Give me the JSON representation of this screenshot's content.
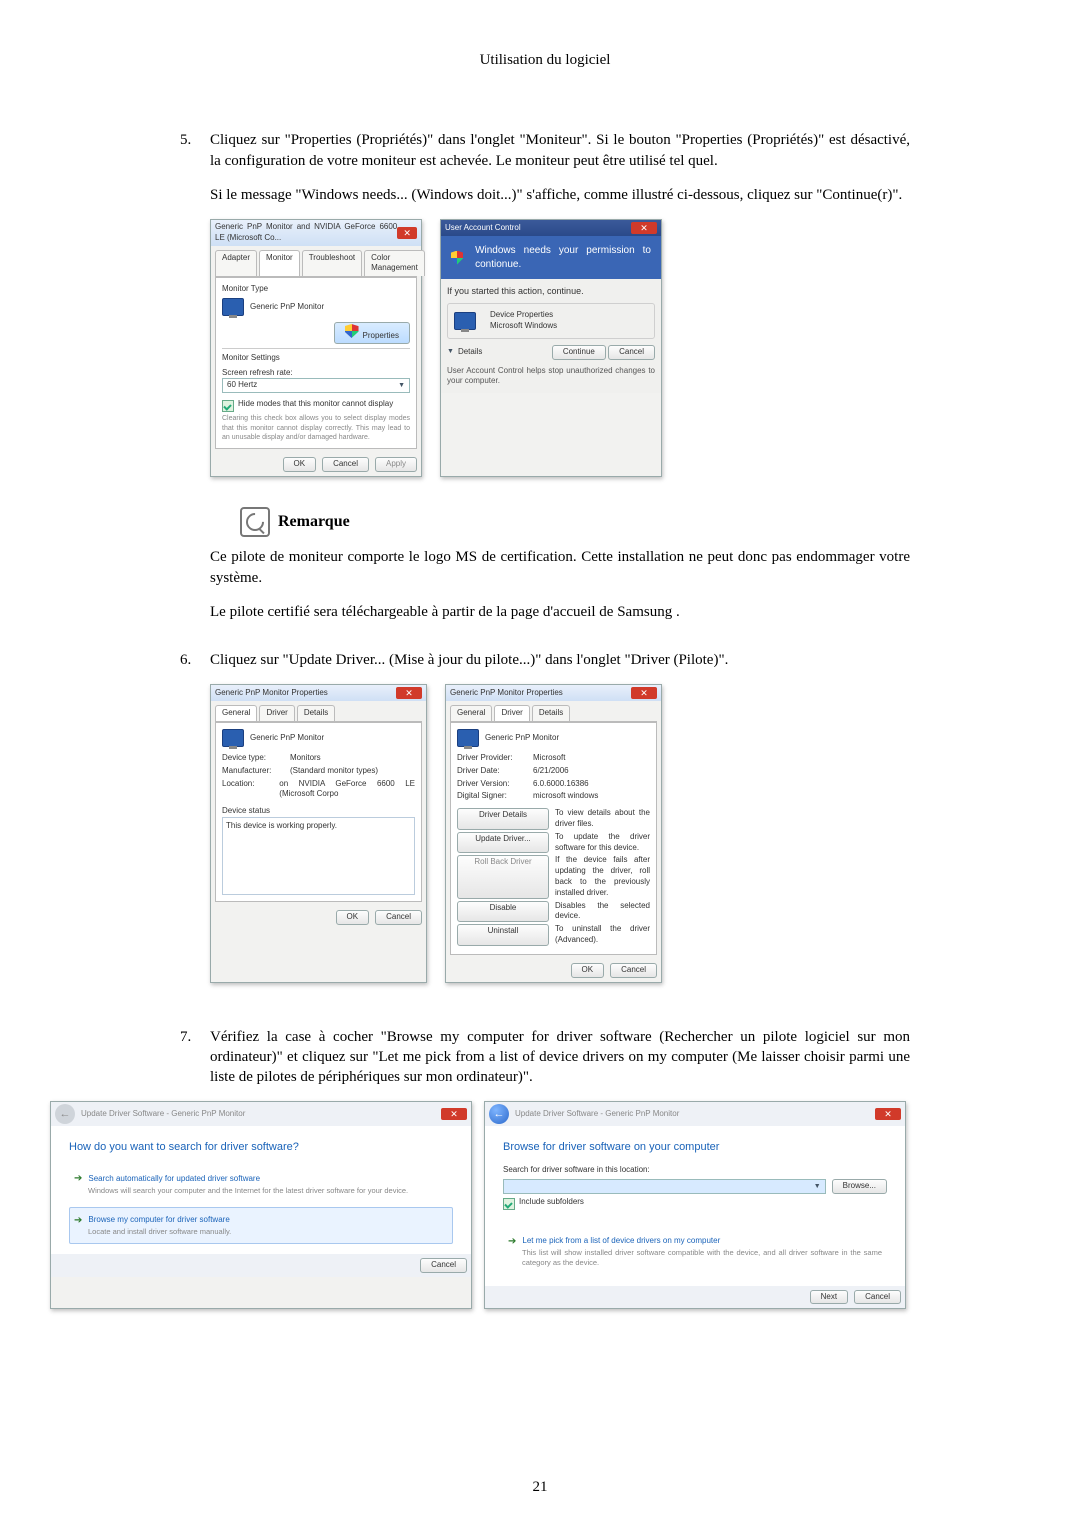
{
  "running_head": "Utilisation du logiciel",
  "page_number": "21",
  "step5": {
    "num": "5.",
    "para1": "Cliquez sur \"Properties (Propriétés)\" dans l'onglet \"Moniteur\". Si le bouton \"Properties (Propriétés)\" est désactivé, la configuration de votre moniteur est achevée. Le moniteur peut être utilisé tel quel.",
    "para2": "Si le message \"Windows needs... (Windows doit...)\" s'affiche, comme illustré ci-dessous, cliquez sur \"Continue(r)\"."
  },
  "fig1_left": {
    "title": "Generic PnP Monitor and NVIDIA GeForce 6600 LE (Microsoft Co...",
    "tabs": [
      "Adapter",
      "Monitor",
      "Troubleshoot",
      "Color Management"
    ],
    "monitor_type_label": "Monitor Type",
    "monitor_name": "Generic PnP Monitor",
    "properties_btn": "Properties",
    "monitor_settings_label": "Monitor Settings",
    "refresh_label": "Screen refresh rate:",
    "refresh_value": "60 Hertz",
    "hide_modes": "Hide modes that this monitor cannot display",
    "hide_modes_desc": "Clearing this check box allows you to select display modes that this monitor cannot display correctly. This may lead to an unusable display and/or damaged hardware.",
    "ok": "OK",
    "cancel": "Cancel",
    "apply": "Apply"
  },
  "fig1_right": {
    "title": "User Account Control",
    "headline": "Windows needs your permission to contionue.",
    "started": "If you started this action, continue.",
    "prog": "Device Properties",
    "publisher": "Microsoft Windows",
    "details": "Details",
    "continue": "Continue",
    "cancel": "Cancel",
    "footer": "User Account Control helps stop unauthorized changes to your computer."
  },
  "note": {
    "title": "Remarque",
    "p1": "Ce pilote de moniteur comporte le logo MS de certification. Cette installation ne peut donc pas endommager votre système.",
    "p2": "Le pilote certifié sera téléchargeable à partir de la page d'accueil de Samsung ."
  },
  "step6": {
    "num": "6.",
    "text": "Cliquez sur \"Update Driver... (Mise à jour du pilote...)\" dans l'onglet \"Driver (Pilote)\"."
  },
  "fig2_left": {
    "title": "Generic PnP Monitor Properties",
    "tabs": [
      "General",
      "Driver",
      "Details"
    ],
    "name": "Generic PnP Monitor",
    "rows": {
      "type_l": "Device type:",
      "type_v": "Monitors",
      "mfr_l": "Manufacturer:",
      "mfr_v": "(Standard monitor types)",
      "loc_l": "Location:",
      "loc_v": "on NVIDIA GeForce 6600 LE (Microsoft Corpo"
    },
    "status_l": "Device status",
    "status_v": "This device is working properly.",
    "ok": "OK",
    "cancel": "Cancel"
  },
  "fig2_right": {
    "title": "Generic PnP Monitor Properties",
    "tabs": [
      "General",
      "Driver",
      "Details"
    ],
    "name": "Generic PnP Monitor",
    "rows": {
      "prov_l": "Driver Provider:",
      "prov_v": "Microsoft",
      "date_l": "Driver Date:",
      "date_v": "6/21/2006",
      "ver_l": "Driver Version:",
      "ver_v": "6.0.6000.16386",
      "sign_l": "Digital Signer:",
      "sign_v": "microsoft windows"
    },
    "btns": {
      "details": "Driver Details",
      "details_d": "To view details about the driver files.",
      "update": "Update Driver...",
      "update_d": "To update the driver software for this device.",
      "rollback": "Roll Back Driver",
      "rollback_d": "If the device fails after updating the driver, roll back to the previously installed driver.",
      "disable": "Disable",
      "disable_d": "Disables the selected device.",
      "uninstall": "Uninstall",
      "uninstall_d": "To uninstall the driver (Advanced)."
    },
    "ok": "OK",
    "cancel": "Cancel"
  },
  "step7": {
    "num": "7.",
    "text": "Vérifiez la case à cocher \"Browse my computer for driver software (Rechercher un pilote logiciel sur mon ordinateur)\" et cliquez sur \"Let me pick from a list of device drivers on my computer (Me laisser choisir parmi une liste de pilotes de périphériques sur mon ordinateur)\"."
  },
  "fig3_left": {
    "crumb": "Update Driver Software - Generic PnP Monitor",
    "heading": "How do you want to search for driver software?",
    "opt1_t": "Search automatically for updated driver software",
    "opt1_d": "Windows will search your computer and the Internet for the latest driver software for your device.",
    "opt2_t": "Browse my computer for driver software",
    "opt2_d": "Locate and install driver software manually.",
    "cancel": "Cancel"
  },
  "fig3_right": {
    "crumb": "Update Driver Software - Generic PnP Monitor",
    "heading": "Browse for driver software on your computer",
    "search_label": "Search for driver software in this location:",
    "path": "",
    "browse": "Browse...",
    "include": "Include subfolders",
    "pick_t": "Let me pick from a list of device drivers on my computer",
    "pick_d": "This list will show installed driver software compatible with the device, and all driver software in the same category as the device.",
    "next": "Next",
    "cancel": "Cancel"
  }
}
